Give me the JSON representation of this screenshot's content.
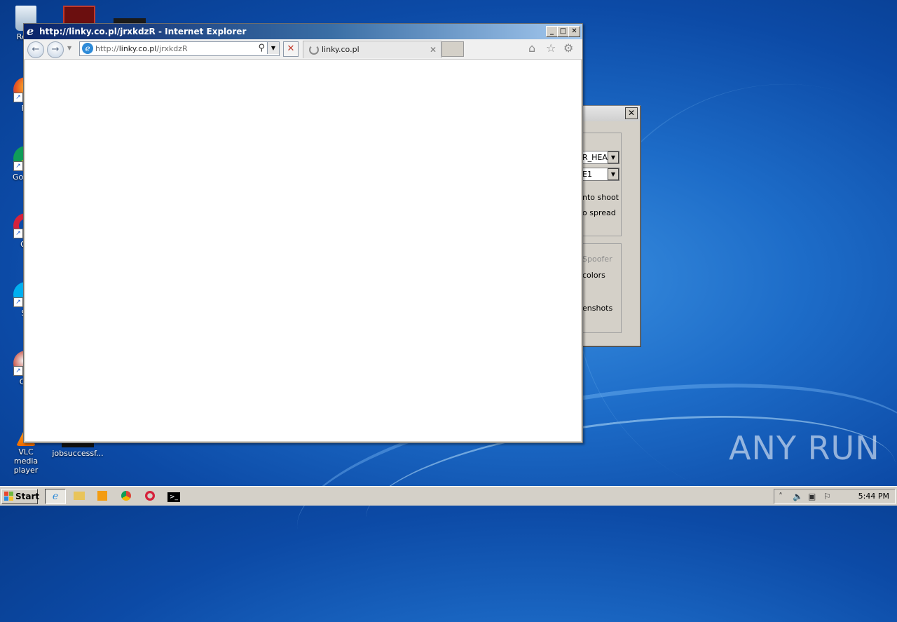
{
  "desktop": {
    "icons": [
      {
        "label": "Recy",
        "icon": "recycle-bin-icon"
      },
      {
        "label": "Fir",
        "icon": "firefox-icon"
      },
      {
        "label": "Go Chr",
        "icon": "chrome-icon"
      },
      {
        "label": "Op",
        "icon": "opera-icon"
      },
      {
        "label": "Sk",
        "icon": "skype-icon"
      },
      {
        "label": "CCl",
        "icon": "ccleaner-icon"
      },
      {
        "label": "VLC media player",
        "icon": "vlc-icon"
      },
      {
        "label": "jobsuccessf...",
        "icon": "file-icon"
      }
    ],
    "watermark": "ANY RUN"
  },
  "background_dialog": {
    "combo1_value": "R_HEA",
    "combo2_value": "E1",
    "options": [
      "nto shoot",
      "o spread",
      "Spoofer",
      "colors",
      "enshots"
    ]
  },
  "ie_window": {
    "title": "http://linky.co.pl/jrxkdzR - Internet Explorer",
    "address": {
      "prefix": "http://",
      "host": "linky.co.pl",
      "path": "/jrxkdzR"
    },
    "tab_label": "linky.co.pl",
    "colors": {
      "title_start": "#0a246a",
      "title_end": "#a6caf0"
    }
  },
  "taskbar": {
    "start_label": "Start",
    "clock": "5:44 PM"
  }
}
